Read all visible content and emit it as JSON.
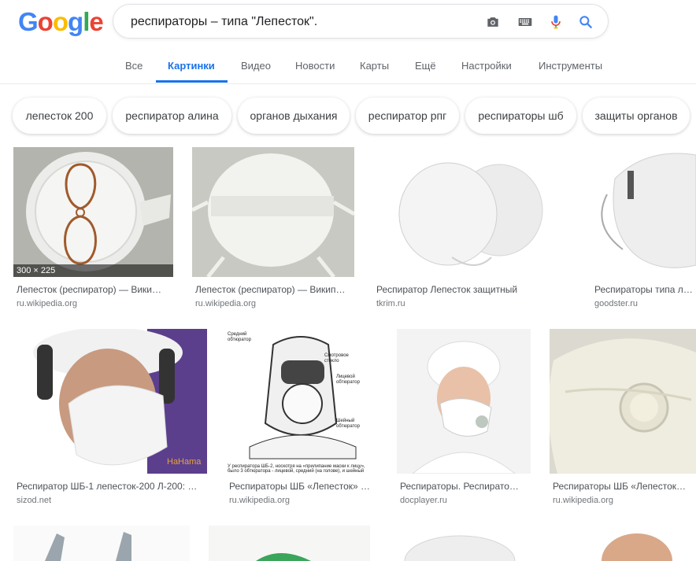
{
  "logo": {
    "g1": "G",
    "o1": "o",
    "o2": "o",
    "g2": "g",
    "l": "l",
    "e": "e"
  },
  "search": {
    "query": "респираторы – типа \"Лепесток\"."
  },
  "tabs": [
    {
      "label": "Все"
    },
    {
      "label": "Картинки"
    },
    {
      "label": "Видео"
    },
    {
      "label": "Новости"
    },
    {
      "label": "Карты"
    },
    {
      "label": "Ещё"
    },
    {
      "label": "Настройки"
    },
    {
      "label": "Инструменты"
    }
  ],
  "chips": [
    {
      "label": "лепесток 200"
    },
    {
      "label": "респиратор алина"
    },
    {
      "label": "органов дыхания"
    },
    {
      "label": "респиратор рпг"
    },
    {
      "label": "респираторы шб"
    },
    {
      "label": "защиты органов"
    }
  ],
  "results": [
    {
      "title": "Лепесток (респиратор) — Вики…",
      "site": "ru.wikipedia.org",
      "dims": "300 × 225"
    },
    {
      "title": "Лепесток (респиратор) — Викип…",
      "site": "ru.wikipedia.org"
    },
    {
      "title": "Респиратор Лепесток защитный",
      "site": "tkrim.ru"
    },
    {
      "title": "Респираторы типа лепе",
      "site": "goodster.ru"
    },
    {
      "title": "Респиратор ШБ-1 лепесток-200 Л-200: …",
      "site": "sizod.net"
    },
    {
      "title": "Респираторы ШБ «Лепесток» …",
      "site": "ru.wikipedia.org"
    },
    {
      "title": "Респираторы. Респирато…",
      "site": "docplayer.ru"
    },
    {
      "title": "Респираторы ШБ «Лепесток…",
      "site": "ru.wikipedia.org"
    }
  ],
  "colors": {
    "accent": "#1a73e8",
    "text_secondary": "#70757a"
  }
}
